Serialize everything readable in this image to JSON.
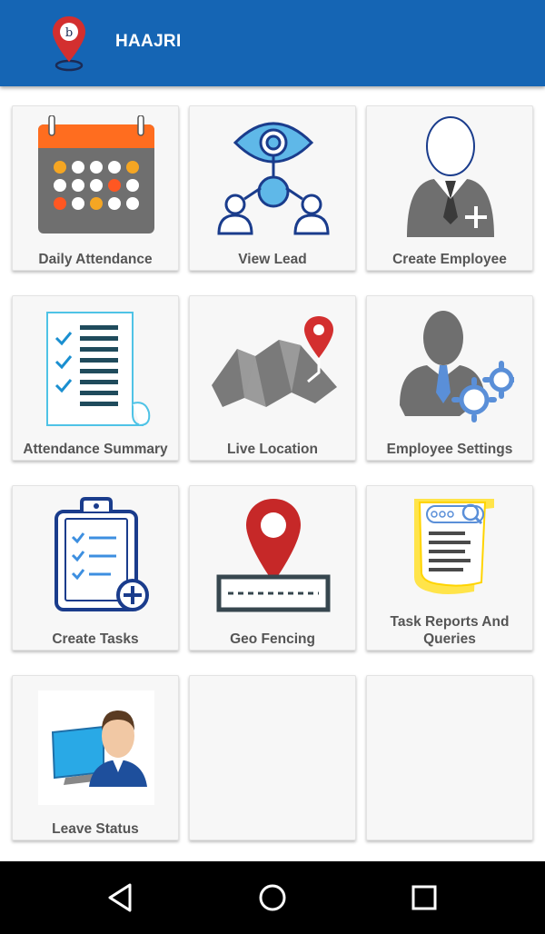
{
  "app": {
    "title": "HAAJRI",
    "logo_icon": "location-pin-logo",
    "bar_color": "#1565b4"
  },
  "tiles": [
    {
      "label": "Daily Attendance",
      "icon": "calendar-icon"
    },
    {
      "label": "View Lead",
      "icon": "eye-network-icon"
    },
    {
      "label": "Create Employee",
      "icon": "add-person-icon"
    },
    {
      "label": "Attendance Summary",
      "icon": "checklist-icon"
    },
    {
      "label": "Live Location",
      "icon": "map-pin-icon"
    },
    {
      "label": "Employee Settings",
      "icon": "person-gears-icon"
    },
    {
      "label": "Create Tasks",
      "icon": "clipboard-plus-icon"
    },
    {
      "label": "Geo Fencing",
      "icon": "geo-fence-icon"
    },
    {
      "label": "Task Reports And Queries",
      "icon": "report-search-icon"
    },
    {
      "label": "Leave Status",
      "icon": "computer-user-icon"
    },
    {
      "label": "",
      "icon": ""
    },
    {
      "label": "",
      "icon": ""
    }
  ],
  "navigation": {
    "back": "back-icon",
    "home": "home-icon",
    "recents": "recents-icon"
  }
}
